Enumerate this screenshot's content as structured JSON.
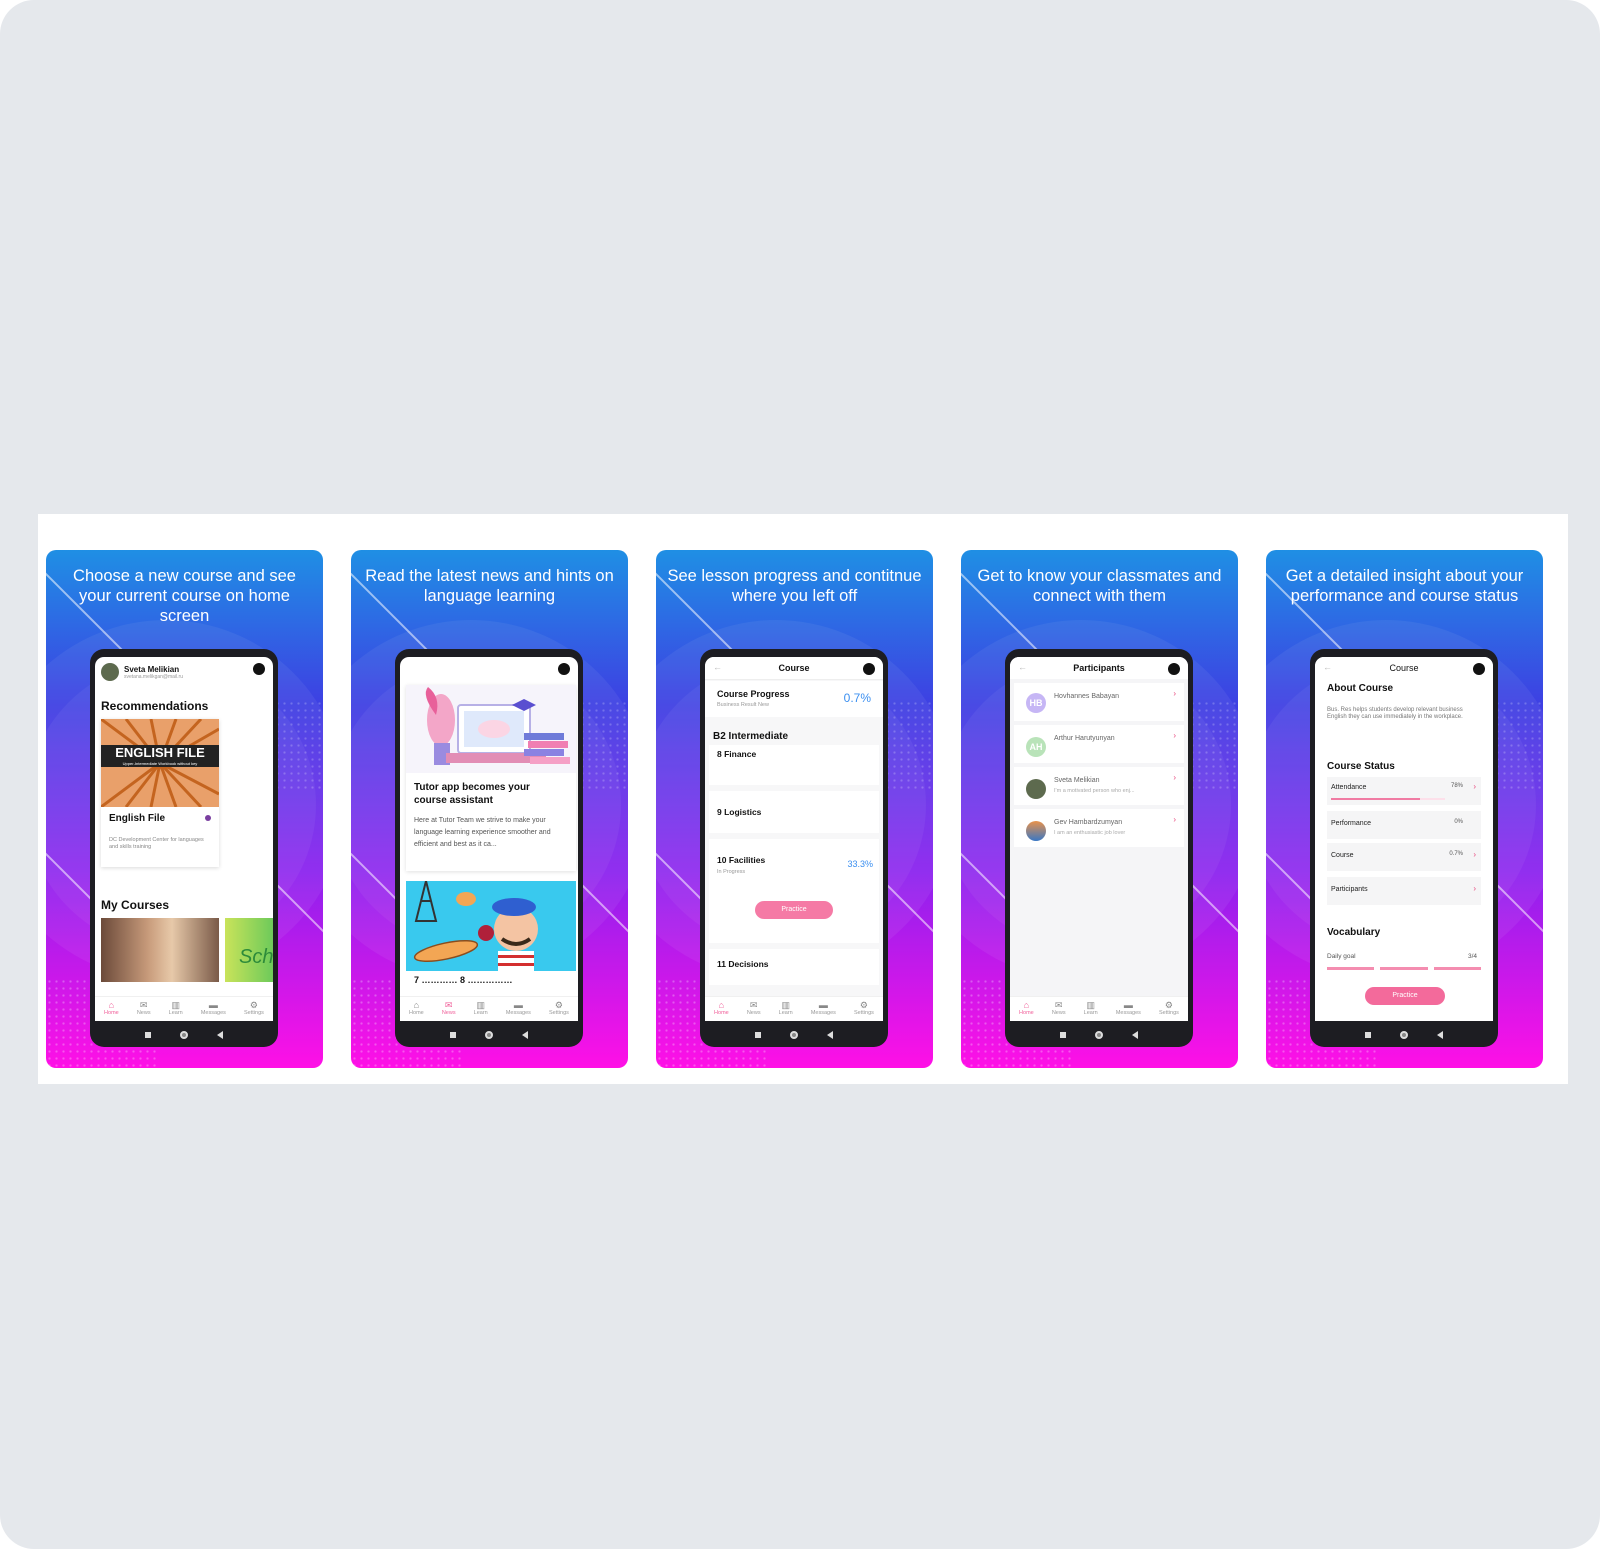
{
  "panels": [
    {
      "caption": "Choose a new course and see your current course on home screen",
      "home": {
        "user_name": "Sveta Melikian",
        "user_email": "svetana.melikgan@mail.ru",
        "recommendations_title": "Recommendations",
        "book_banner": "ENGLISH FILE",
        "book_subtitle": "Upper-Intermediate  Workbook without key",
        "course_title": "English File",
        "course_org": "DC Development Center for languages and skills training",
        "my_courses_title": "My Courses",
        "sch_text": "Sch"
      }
    },
    {
      "caption": "Read the latest news and hints on language learning",
      "news": {
        "article_title": "Tutor app becomes your course assistant",
        "article_excerpt": "Here at Tutor Team we strive to make your language learning experience smoother and efficient and best as it ca...",
        "second_title": "7 ………… 8 ……………"
      }
    },
    {
      "caption": "See lesson progress and contitnue where you left off",
      "course": {
        "header": "Course",
        "progress_label": "Course Progress",
        "progress_sub": "Business Result New",
        "progress_value": "0.7%",
        "level": "B2 Intermediate",
        "lessons": [
          {
            "title": "8 Finance",
            "status": "",
            "value": ""
          },
          {
            "title": "9 Logistics",
            "status": "",
            "value": ""
          },
          {
            "title": "10 Facilities",
            "status": "In Progress",
            "value": "33.3%"
          },
          {
            "title": "11 Decisions",
            "status": "",
            "value": ""
          }
        ],
        "practice_label": "Practice"
      }
    },
    {
      "caption": "Get to know your classmates and connect with them",
      "participants": {
        "header": "Participants",
        "list": [
          {
            "initials": "HB",
            "name": "Hovhannes Babayan",
            "bio": "",
            "color": "#c6b6f5"
          },
          {
            "initials": "AH",
            "name": "Arthur Harutyunyan",
            "bio": "",
            "color": "#b9e3b9"
          },
          {
            "initials": "",
            "name": "Sveta Melikian",
            "bio": "I'm a motivated person who enj...",
            "color": "#5d6a4e"
          },
          {
            "initials": "",
            "name": "Gev Hambardzumyan",
            "bio": "I am an enthusiastic job lover",
            "color": "#3a77c4"
          }
        ]
      }
    },
    {
      "caption": "Get a detailed insight about your performance and course status",
      "insight": {
        "header": "Course",
        "about_title": "About Course",
        "about_text": "Bus. Res helps students develop relevant business English they can use immediately in the workplace.",
        "status_title": "Course Status",
        "rows": [
          {
            "label": "Attendance",
            "value": "78%",
            "fill": 0.78,
            "arrow": true
          },
          {
            "label": "Performance",
            "value": "0%",
            "fill": 0,
            "arrow": false
          },
          {
            "label": "Course",
            "value": "0.7%",
            "fill": 0.007,
            "arrow": true
          },
          {
            "label": "Participants",
            "value": "",
            "fill": 0,
            "arrow": true
          }
        ],
        "vocab_title": "Vocabulary",
        "daily_goal_label": "Daily goal",
        "daily_goal_value": "3/4",
        "practice_label": "Practice"
      }
    }
  ],
  "tabbar": {
    "home": "Home",
    "news": "News",
    "learn": "Learn",
    "messages": "Messages",
    "settings": "Settings"
  },
  "icons": {
    "home": "home-icon",
    "news": "megaphone-icon",
    "learn": "book-icon",
    "messages": "chat-icon",
    "settings": "gear-icon"
  },
  "colors": {
    "accent": "#f0609a",
    "progress_blue": "#3b8ff0"
  }
}
